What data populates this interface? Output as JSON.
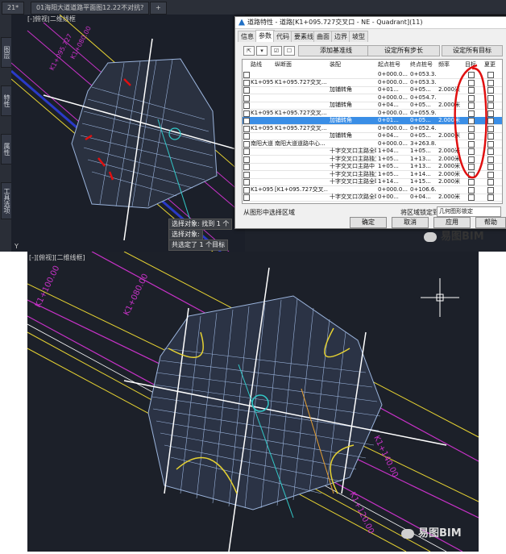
{
  "top_tabs": [
    "21*",
    "01海阳大道道路平面图12.22不对抗?",
    "+"
  ],
  "left_strip_tabs": [
    "图层",
    "特性",
    "属性",
    "工具选项"
  ],
  "top_view_label": "[-]俯视|二维线框",
  "command_lines": [
    "选择对象: 找到 1 个",
    "选择对象:",
    "共选定了 1 个目标"
  ],
  "dialog": {
    "title": "道路特性 - 道路[K1+095.727交叉口 - NE - Quadrant](11)",
    "tabs": [
      "信息",
      "参数",
      "代码",
      "要素线",
      "曲面",
      "边界",
      "坡型"
    ],
    "active_tab": "参数",
    "toolbar_buttons": [
      "添加基准线",
      "设定所有步长",
      "设定所有目标"
    ],
    "columns": [
      "路线",
      "纵断面",
      "装配",
      "起点桩号",
      "终点桩号",
      "频率",
      "目标",
      "夏更"
    ],
    "rows": [
      {
        "route": "",
        "profile": "",
        "assembly": "",
        "start": "0+000.0...",
        "end": "0+053.3...",
        "freq": "",
        "sel": false
      },
      {
        "route": "K1+095...",
        "profile": "K1+095.727交叉...",
        "assembly": "",
        "start": "0+000.0...",
        "end": "0+053.3...",
        "freq": "",
        "sel": false
      },
      {
        "route": "",
        "profile": "",
        "assembly": "加铺转角",
        "start": "0+01...",
        "end": "0+05...",
        "freq": "2.000米",
        "sel": false
      },
      {
        "route": "",
        "profile": "",
        "assembly": "",
        "start": "0+000.0...",
        "end": "0+054.7...",
        "freq": "",
        "sel": false
      },
      {
        "route": "",
        "profile": "",
        "assembly": "加铺转角",
        "start": "0+04...",
        "end": "0+05...",
        "freq": "2.000米",
        "sel": false
      },
      {
        "route": "K1+095...",
        "profile": "K1+095.727交叉...",
        "assembly": "",
        "start": "0+000.0...",
        "end": "0+055.9...",
        "freq": "",
        "sel": false
      },
      {
        "route": "",
        "profile": "",
        "assembly": "加铺转角",
        "start": "0+01...",
        "end": "0+05...",
        "freq": "2.000米",
        "sel": true
      },
      {
        "route": "K1+095...",
        "profile": "K1+095.727交叉...",
        "assembly": "",
        "start": "0+000.0...",
        "end": "0+052.4...",
        "freq": "",
        "sel": false
      },
      {
        "route": "",
        "profile": "",
        "assembly": "加铺转角",
        "start": "0+04...",
        "end": "0+05...",
        "freq": "2.000米",
        "sel": false
      },
      {
        "route": "南阳大道...",
        "profile": "南阳大道道路中心...",
        "assembly": "",
        "start": "0+000.0...",
        "end": "3+263.8...",
        "freq": "",
        "sel": false
      },
      {
        "route": "",
        "profile": "",
        "assembly": "十字交叉口主路全断面",
        "start": "1+04...",
        "end": "1+05...",
        "freq": "2.000米",
        "sel": false
      },
      {
        "route": "",
        "profile": "",
        "assembly": "十字交叉口主路独立块左",
        "start": "1+05...",
        "end": "1+13...",
        "freq": "2.000米",
        "sel": false
      },
      {
        "route": "",
        "profile": "",
        "assembly": "十字交叉口主路中",
        "start": "1+05...",
        "end": "1+13...",
        "freq": "2.000米",
        "sel": false
      },
      {
        "route": "",
        "profile": "",
        "assembly": "十字交叉口主路独立块右",
        "start": "1+05...",
        "end": "1+14...",
        "freq": "2.000米",
        "sel": false
      },
      {
        "route": "",
        "profile": "",
        "assembly": "十字交叉口主路全断面",
        "start": "1+14...",
        "end": "1+15...",
        "freq": "2.000米",
        "sel": false
      },
      {
        "route": "K1+095...",
        "profile": "[K1+095.727交叉...",
        "assembly": "",
        "start": "0+000.0...",
        "end": "0+106.6...",
        "freq": "",
        "sel": false
      },
      {
        "route": "",
        "profile": "",
        "assembly": "十字交叉口次路全断面",
        "start": "0+00...",
        "end": "0+04...",
        "freq": "2.000米",
        "sel": false
      }
    ],
    "footer_label": "从图形中选择区域",
    "footer_right_label": "将区域锁定到:",
    "footer_select": "几何图形锁定",
    "buttons": [
      "确定",
      "取消",
      "应用",
      "帮助"
    ]
  },
  "watermark_text": "易图BIM",
  "bottom_view_label": "[-][俯视][二维线框]",
  "bottom_stations": [
    "K1+100.00",
    "K1+080.00",
    "K1+140.00",
    "K1+120.00"
  ],
  "top_stations": [
    "K1+095.727",
    "K1+080.00"
  ],
  "colors": {
    "cad_background": "#1c2029",
    "road_magenta": "#c832c8",
    "curve_yellow": "#e6d232",
    "hatch_blue": "#9bb4dc",
    "center_cyan": "#32c8c8",
    "selection_blue": "#3a8ee6",
    "annotation_red": "#e01010"
  }
}
